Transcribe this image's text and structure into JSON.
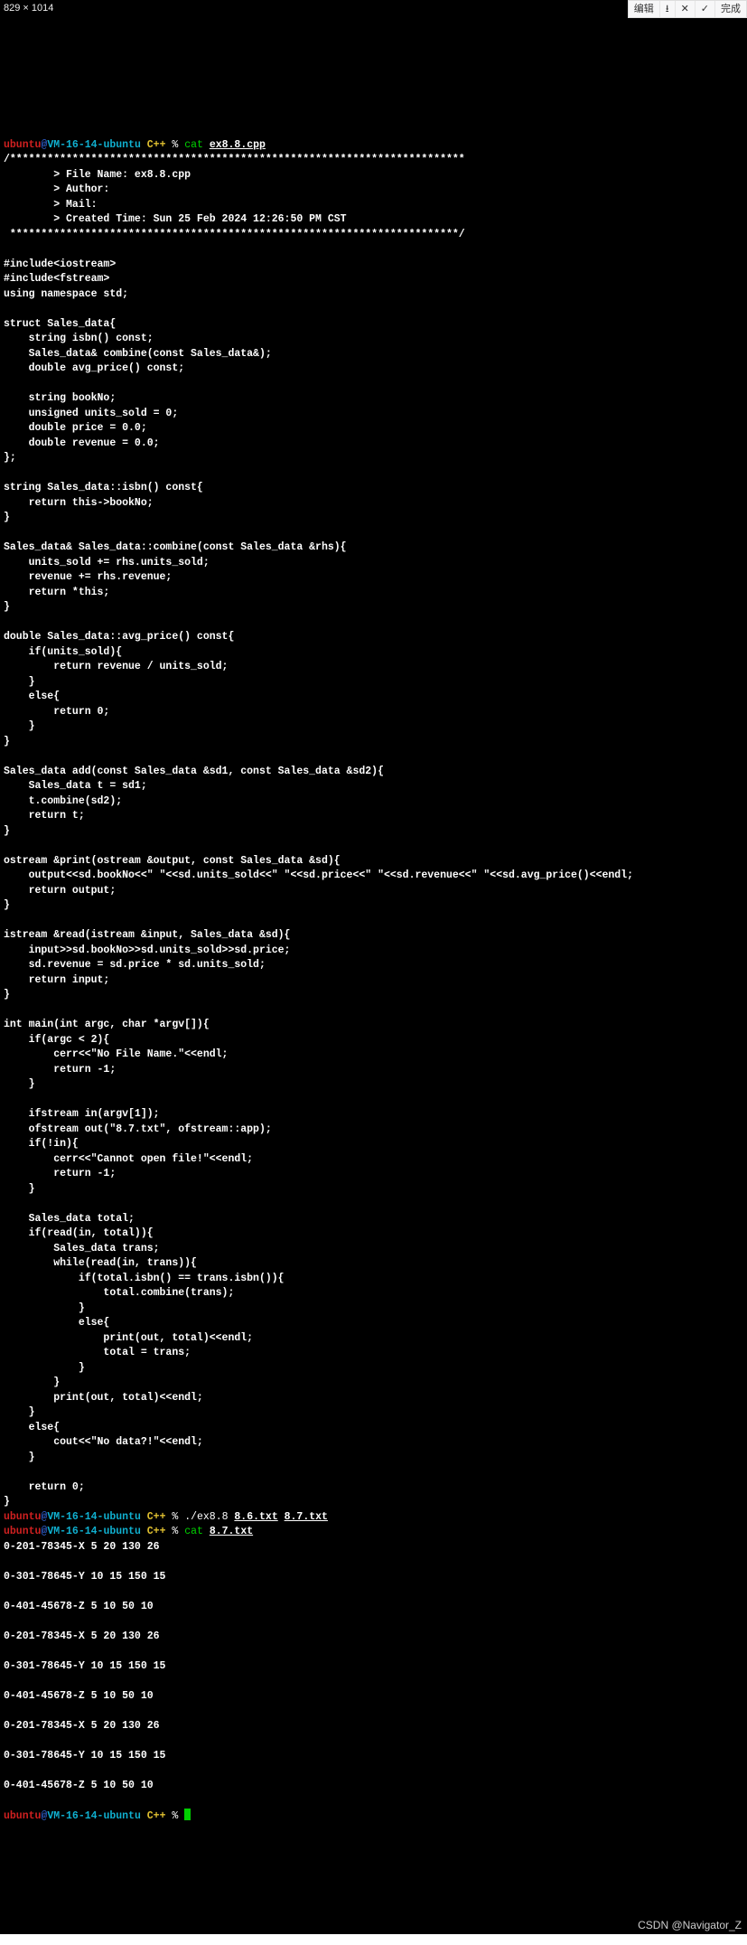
{
  "dim_label": "829 × 1014",
  "top_bar": {
    "edit": "编辑",
    "down": "⭳",
    "close": "✕",
    "check": "✓",
    "done": "完成"
  },
  "watermark": "CSDN @Navigator_Z",
  "prompt": {
    "user": "ubuntu",
    "at": "@",
    "host": "VM-16-14-ubuntu",
    "dir": " C++",
    "sep": " % "
  },
  "cmd1": {
    "cat": "cat",
    "arg": "ex8.8.cpp"
  },
  "header": {
    "l1": "/*************************************************************************",
    "l2": "        > File Name: ex8.8.cpp",
    "l3": "        > Author:",
    "l4": "        > Mail:",
    "l5": "        > Created Time: Sun 25 Feb 2024 12:26:50 PM CST",
    "l6": " ************************************************************************/"
  },
  "code": [
    "",
    "#include<iostream>",
    "#include<fstream>",
    "using namespace std;",
    "",
    "struct Sales_data{",
    "    string isbn() const;",
    "    Sales_data& combine(const Sales_data&);",
    "    double avg_price() const;",
    "",
    "    string bookNo;",
    "    unsigned units_sold = 0;",
    "    double price = 0.0;",
    "    double revenue = 0.0;",
    "};",
    "",
    "string Sales_data::isbn() const{",
    "    return this->bookNo;",
    "}",
    "",
    "Sales_data& Sales_data::combine(const Sales_data &rhs){",
    "    units_sold += rhs.units_sold;",
    "    revenue += rhs.revenue;",
    "    return *this;",
    "}",
    "",
    "double Sales_data::avg_price() const{",
    "    if(units_sold){",
    "        return revenue / units_sold;",
    "    }",
    "    else{",
    "        return 0;",
    "    }",
    "}",
    "",
    "Sales_data add(const Sales_data &sd1, const Sales_data &sd2){",
    "    Sales_data t = sd1;",
    "    t.combine(sd2);",
    "    return t;",
    "}",
    "",
    "ostream &print(ostream &output, const Sales_data &sd){",
    "    output<<sd.bookNo<<\" \"<<sd.units_sold<<\" \"<<sd.price<<\" \"<<sd.revenue<<\" \"<<sd.avg_price()<<endl;",
    "    return output;",
    "}",
    "",
    "istream &read(istream &input, Sales_data &sd){",
    "    input>>sd.bookNo>>sd.units_sold>>sd.price;",
    "    sd.revenue = sd.price * sd.units_sold;",
    "    return input;",
    "}",
    "",
    "int main(int argc, char *argv[]){",
    "    if(argc < 2){",
    "        cerr<<\"No File Name.\"<<endl;",
    "        return -1;",
    "    }",
    "",
    "    ifstream in(argv[1]);",
    "    ofstream out(\"8.7.txt\", ofstream::app);",
    "    if(!in){",
    "        cerr<<\"Cannot open file!\"<<endl;",
    "        return -1;",
    "    }",
    "",
    "    Sales_data total;",
    "    if(read(in, total)){",
    "        Sales_data trans;",
    "        while(read(in, trans)){",
    "            if(total.isbn() == trans.isbn()){",
    "                total.combine(trans);",
    "            }",
    "            else{",
    "                print(out, total)<<endl;",
    "                total = trans;",
    "            }",
    "        }",
    "        print(out, total)<<endl;",
    "    }",
    "    else{",
    "        cout<<\"No data?!\"<<endl;",
    "    }",
    "",
    "    return 0;",
    "}"
  ],
  "cmd2": {
    "pre": "./ex8.8 ",
    "a1": "8.6.txt",
    "sp": " ",
    "a2": "8.7.txt"
  },
  "cmd3": {
    "cat": "cat",
    "sp": " ",
    "arg": "8.7.txt"
  },
  "output": [
    "0-201-78345-X 5 20 130 26",
    "",
    "0-301-78645-Y 10 15 150 15",
    "",
    "0-401-45678-Z 5 10 50 10",
    "",
    "0-201-78345-X 5 20 130 26",
    "",
    "0-301-78645-Y 10 15 150 15",
    "",
    "0-401-45678-Z 5 10 50 10",
    "",
    "0-201-78345-X 5 20 130 26",
    "",
    "0-301-78645-Y 10 15 150 15",
    "",
    "0-401-45678-Z 5 10 50 10",
    ""
  ]
}
